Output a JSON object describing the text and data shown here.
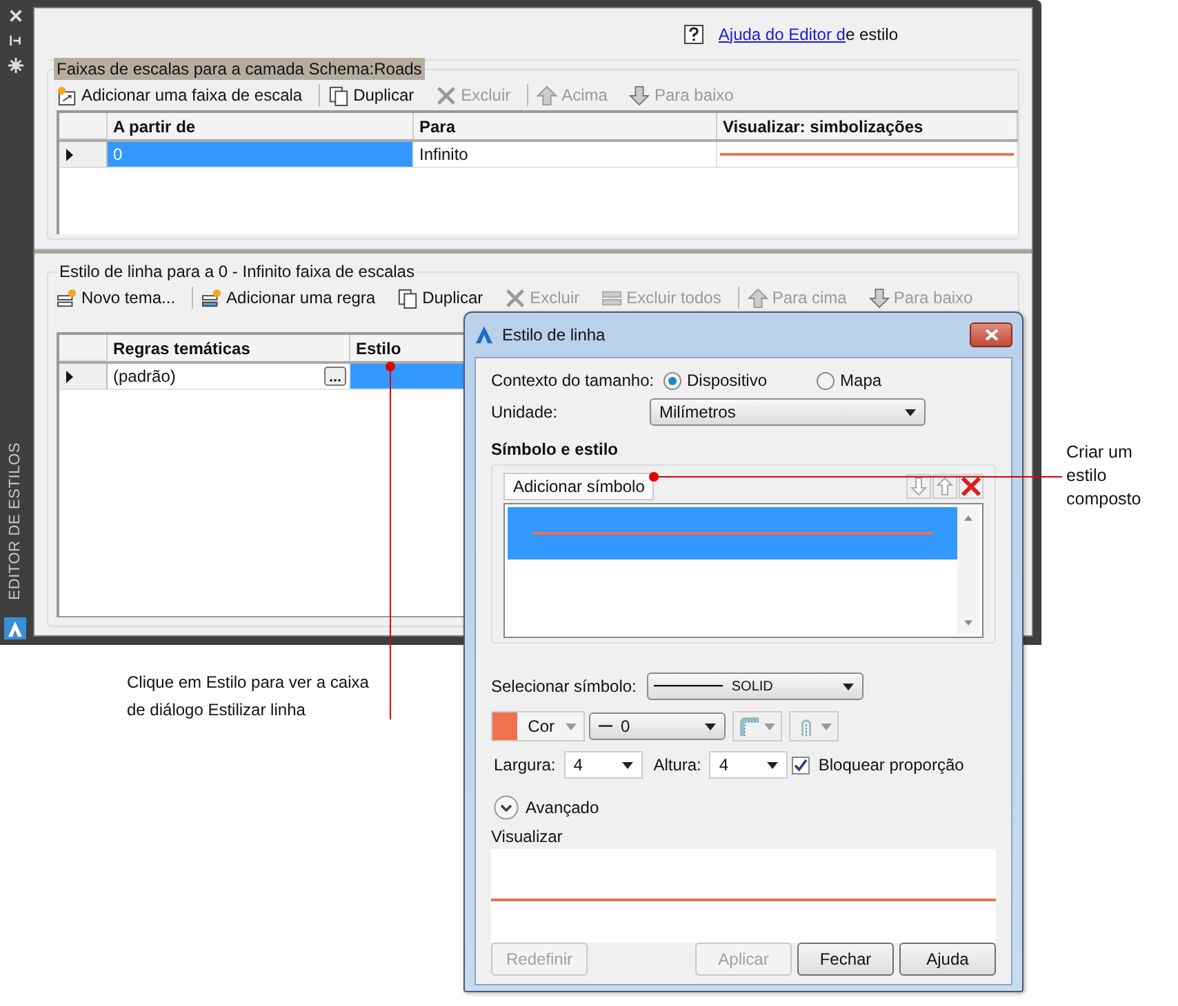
{
  "sidebar": {
    "title": "EDITOR DE ESTILOS"
  },
  "help": {
    "link": "Ajuda do Editor d",
    "text": "e estilo"
  },
  "scale_ranges": {
    "title": "Faixas de escalas para a camada Schema:Roads",
    "toolbar": [
      {
        "kind": "addrange",
        "label": "Adicionar uma faixa de escala",
        "disabled": false
      },
      {
        "kind": "duplicate",
        "label": "Duplicar",
        "disabled": false
      },
      {
        "kind": "delete",
        "label": "Excluir",
        "disabled": true
      },
      {
        "kind": "up",
        "label": "Acima",
        "disabled": true
      },
      {
        "kind": "down",
        "label": "Para baixo",
        "disabled": true
      }
    ],
    "columns": [
      "A partir de",
      "Para",
      "Visualizar: simbolizações"
    ],
    "rows": [
      {
        "from": "0",
        "to": "Infinito",
        "selected": true
      }
    ]
  },
  "line_style": {
    "title": "Estilo de linha para a 0 - Infinito faixa de escalas",
    "toolbar": [
      {
        "kind": "theme",
        "label": "Novo tema...",
        "disabled": false
      },
      {
        "kind": "rule",
        "label": "Adicionar uma regra",
        "disabled": false
      },
      {
        "kind": "duplicate",
        "label": "Duplicar",
        "disabled": false
      },
      {
        "kind": "delete",
        "label": "Excluir",
        "disabled": true
      },
      {
        "kind": "deleteall",
        "label": "Excluir todos",
        "disabled": true
      },
      {
        "kind": "up",
        "label": "Para cima",
        "disabled": true
      },
      {
        "kind": "down",
        "label": "Para baixo",
        "disabled": true
      }
    ],
    "columns": [
      "Regras temáticas",
      "Estilo"
    ],
    "rows": [
      {
        "rule": "(padrão)",
        "selected": true
      }
    ]
  },
  "dialog": {
    "title": "Estilo de linha",
    "size_context": {
      "label": "Contexto do tamanho:",
      "options": [
        {
          "label": "Dispositivo",
          "selected": true
        },
        {
          "label": "Mapa",
          "selected": false
        }
      ]
    },
    "unit": {
      "label": "Unidade:",
      "value": "Milímetros"
    },
    "section": "Símbolo e estilo",
    "add_symbol": "Adicionar símbolo",
    "symbols": [
      {
        "selected": true
      }
    ],
    "select_symbol": {
      "label": "Selecionar símbolo:",
      "value": "SOLID"
    },
    "color": {
      "label": "Cor",
      "color": "#f07050"
    },
    "line_weight": "0",
    "width": {
      "label": "Largura:",
      "value": "4"
    },
    "height": {
      "label": "Altura:",
      "value": "4"
    },
    "lock": {
      "label": "Bloquear proporção",
      "checked": true
    },
    "advanced": {
      "label": "Avançado",
      "expanded": false
    },
    "preview": {
      "label": "Visualizar"
    },
    "buttons": [
      {
        "label": "Redefinir",
        "disabled": true
      },
      {
        "label": "Aplicar",
        "disabled": true
      },
      {
        "label": "Fechar",
        "disabled": false
      },
      {
        "label": "Ajuda",
        "disabled": false
      }
    ]
  },
  "callouts": [
    {
      "text": "Criar um estilo composto"
    },
    {
      "text": "Clique em Estilo para ver a caixa de diálogo Estilizar linha"
    }
  ]
}
